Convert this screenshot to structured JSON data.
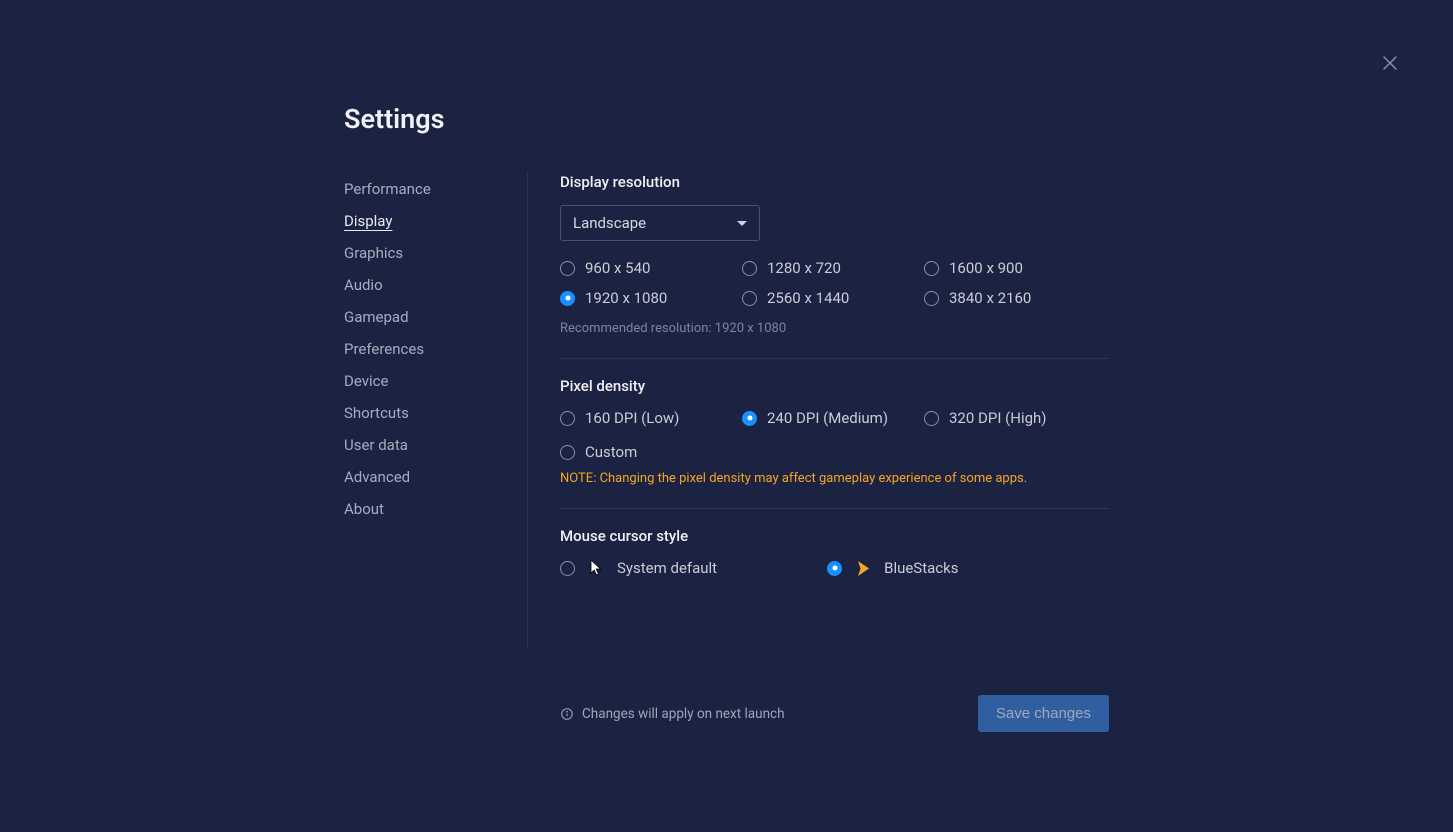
{
  "page_title": "Settings",
  "sidebar": {
    "items": [
      {
        "label": "Performance",
        "active": false
      },
      {
        "label": "Display",
        "active": true
      },
      {
        "label": "Graphics",
        "active": false
      },
      {
        "label": "Audio",
        "active": false
      },
      {
        "label": "Gamepad",
        "active": false
      },
      {
        "label": "Preferences",
        "active": false
      },
      {
        "label": "Device",
        "active": false
      },
      {
        "label": "Shortcuts",
        "active": false
      },
      {
        "label": "User data",
        "active": false
      },
      {
        "label": "Advanced",
        "active": false
      },
      {
        "label": "About",
        "active": false
      }
    ]
  },
  "display": {
    "resolution_title": "Display resolution",
    "orientation_selected": "Landscape",
    "resolutions": [
      {
        "label": "960 x 540",
        "selected": false
      },
      {
        "label": "1280 x 720",
        "selected": false
      },
      {
        "label": "1600 x 900",
        "selected": false
      },
      {
        "label": "1920 x 1080",
        "selected": true
      },
      {
        "label": "2560 x 1440",
        "selected": false
      },
      {
        "label": "3840 x 2160",
        "selected": false
      }
    ],
    "recommended_text": "Recommended resolution: 1920 x 1080"
  },
  "pixel_density": {
    "title": "Pixel density",
    "options": [
      {
        "label": "160 DPI (Low)",
        "selected": false
      },
      {
        "label": "240 DPI (Medium)",
        "selected": true
      },
      {
        "label": "320 DPI (High)",
        "selected": false
      },
      {
        "label": "Custom",
        "selected": false
      }
    ],
    "note": "NOTE: Changing the pixel density may affect gameplay experience of some apps."
  },
  "cursor": {
    "title": "Mouse cursor style",
    "options": [
      {
        "label": "System default",
        "selected": false,
        "icon": "arrow"
      },
      {
        "label": "BlueStacks",
        "selected": true,
        "icon": "bs"
      }
    ]
  },
  "footer": {
    "info_text": "Changes will apply on next launch",
    "save_label": "Save changes"
  }
}
